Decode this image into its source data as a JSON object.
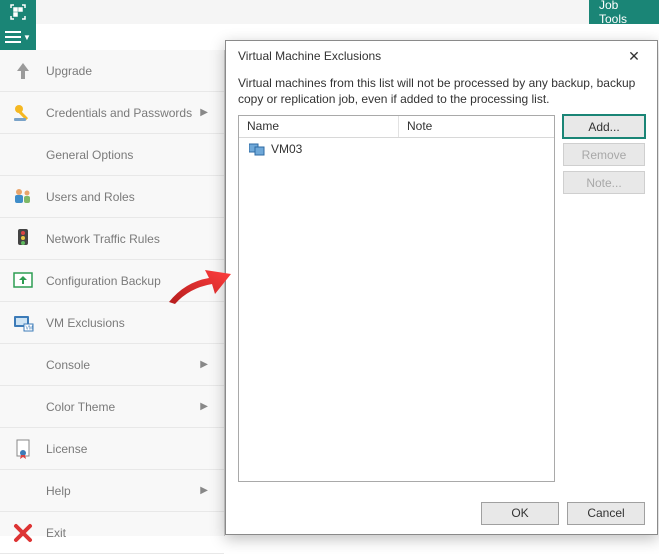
{
  "topbar": {
    "job_tools": "Job Tools"
  },
  "menu": {
    "items": [
      {
        "label": "Upgrade"
      },
      {
        "label": "Credentials and Passwords",
        "sub": true
      },
      {
        "label": "General Options"
      },
      {
        "label": "Users and Roles"
      },
      {
        "label": "Network Traffic Rules"
      },
      {
        "label": "Configuration Backup"
      },
      {
        "label": "VM Exclusions"
      },
      {
        "label": "Console",
        "sub": true
      },
      {
        "label": "Color Theme",
        "sub": true
      },
      {
        "label": "License"
      },
      {
        "label": "Help",
        "sub": true
      },
      {
        "label": "Exit"
      }
    ]
  },
  "dialog": {
    "title": "Virtual Machine Exclusions",
    "description": "Virtual machines from this list will not be processed by any backup, backup copy or replication job, even if added to the processing list.",
    "columns": {
      "name": "Name",
      "note": "Note"
    },
    "rows": [
      {
        "name": "VM03",
        "note": ""
      }
    ],
    "buttons": {
      "add": "Add...",
      "remove": "Remove",
      "note": "Note..."
    },
    "footer": {
      "ok": "OK",
      "cancel": "Cancel"
    }
  }
}
